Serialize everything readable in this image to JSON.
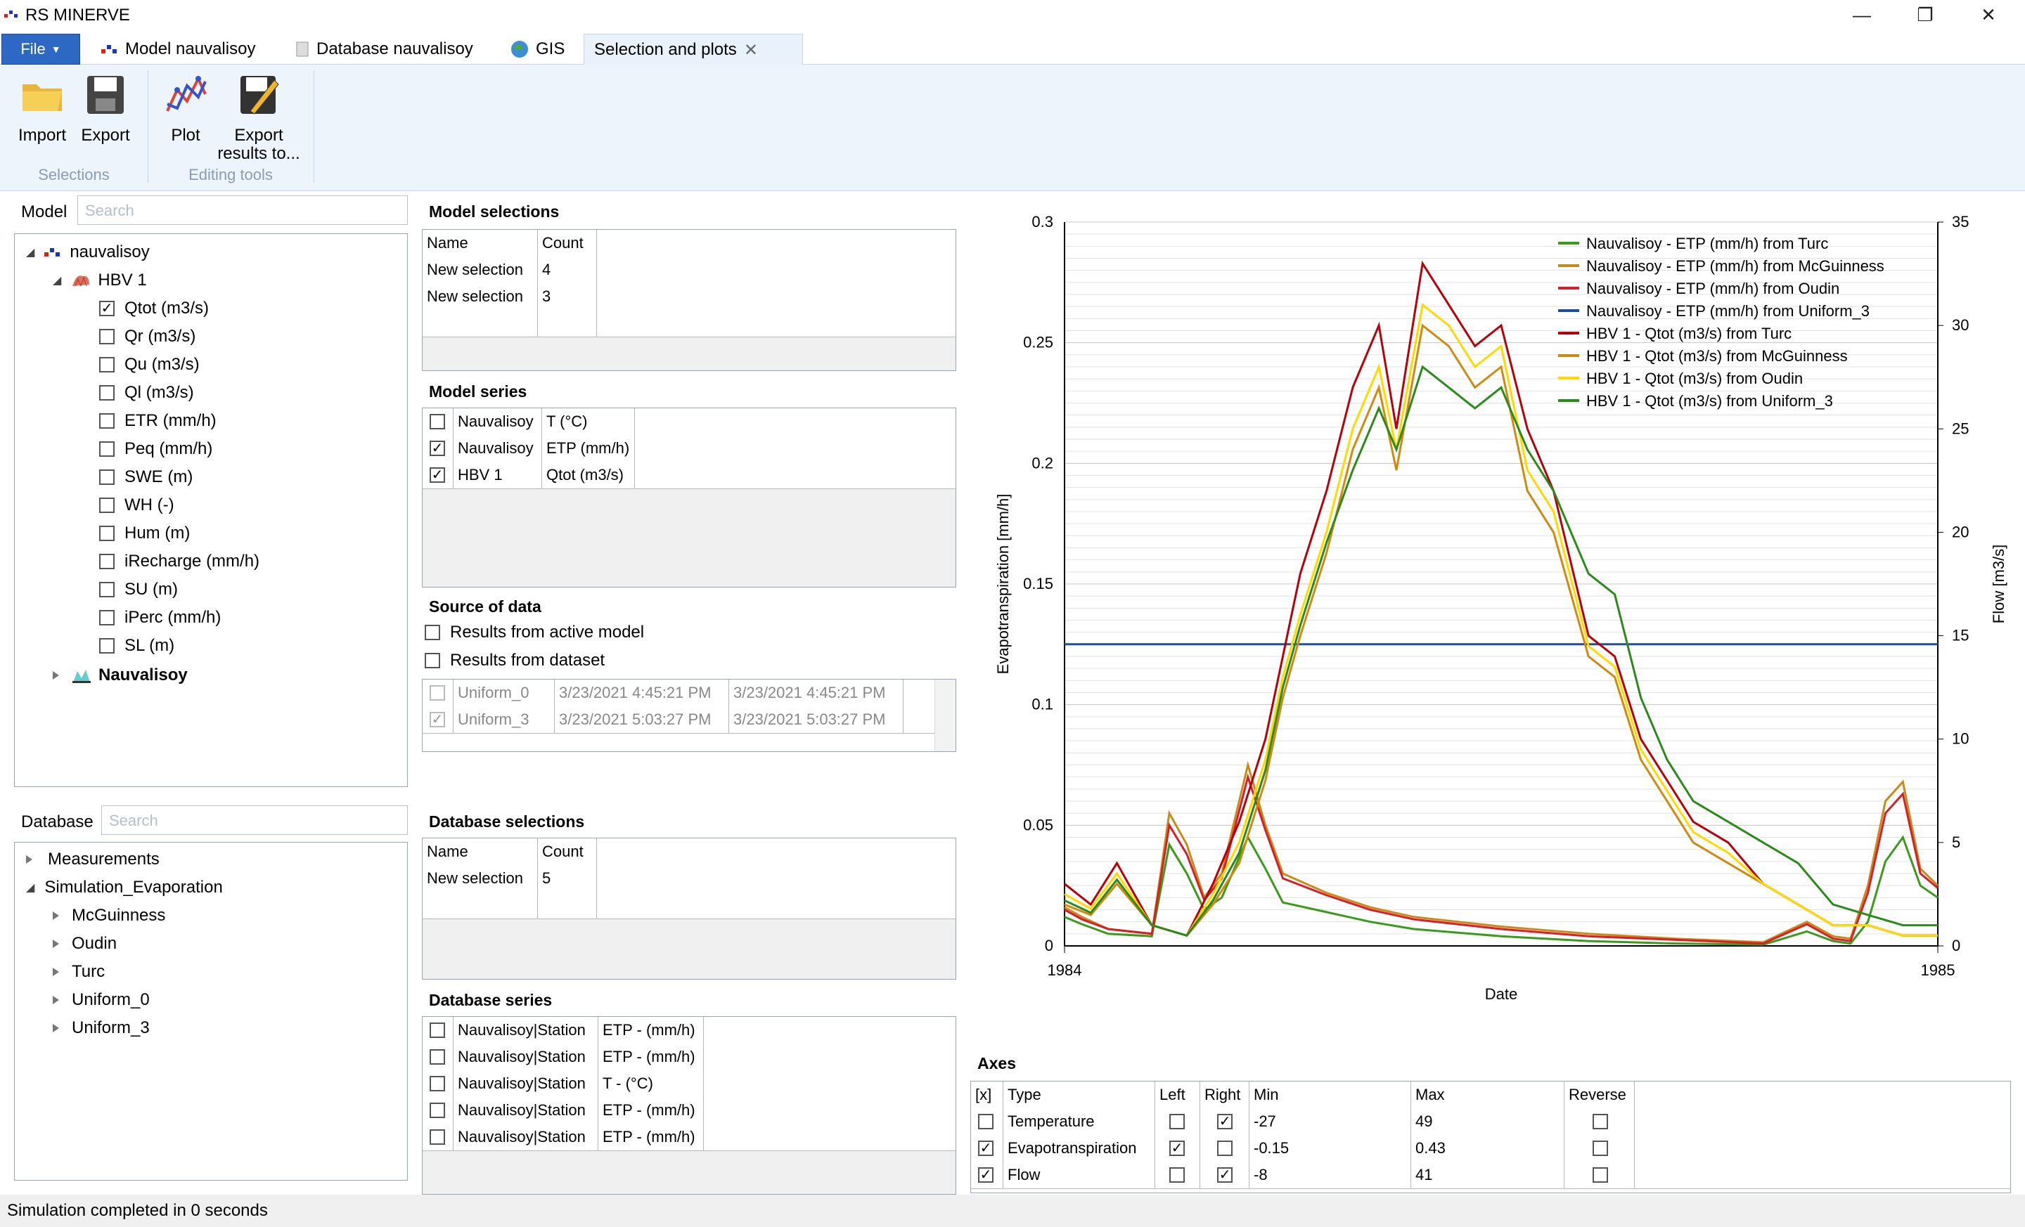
{
  "app": {
    "title": "RS MINERVE"
  },
  "window_controls": {
    "minimize": "—",
    "restore": "❐",
    "close": "✕"
  },
  "tabs": [
    {
      "label": "File"
    },
    {
      "label": "Model nauvalisoy"
    },
    {
      "label": "Database nauvalisoy"
    },
    {
      "label": "GIS"
    },
    {
      "label": "Selection and plots",
      "active": true
    }
  ],
  "ribbon": {
    "buttons": [
      {
        "label": "Import",
        "icon": "folder-icon"
      },
      {
        "label": "Export",
        "icon": "save-icon"
      },
      {
        "label": "Plot",
        "icon": "plot-icon"
      },
      {
        "label": "Export",
        "label2": "results to...",
        "icon": "export-results-icon"
      }
    ],
    "groups": [
      "Selections",
      "Editing tools"
    ]
  },
  "model": {
    "label": "Model",
    "search_placeholder": "Search",
    "tree": {
      "root": "nauvalisoy",
      "child": "HBV 1",
      "items": [
        {
          "label": "Qtot (m3/s)",
          "checked": true
        },
        {
          "label": "Qr (m3/s)",
          "checked": false
        },
        {
          "label": "Qu (m3/s)",
          "checked": false
        },
        {
          "label": "Ql (m3/s)",
          "checked": false
        },
        {
          "label": "ETR (mm/h)",
          "checked": false
        },
        {
          "label": "Peq (mm/h)",
          "checked": false
        },
        {
          "label": "SWE (m)",
          "checked": false
        },
        {
          "label": "WH (-)",
          "checked": false
        },
        {
          "label": "Hum (m)",
          "checked": false
        },
        {
          "label": "iRecharge (mm/h)",
          "checked": false
        },
        {
          "label": "SU (m)",
          "checked": false
        },
        {
          "label": "iPerc (mm/h)",
          "checked": false
        },
        {
          "label": "SL (m)",
          "checked": false
        }
      ],
      "station": "Nauvalisoy"
    }
  },
  "database": {
    "label": "Database",
    "search_placeholder": "Search",
    "tree": {
      "items": [
        "Measurements",
        "Simulation_Evaporation"
      ],
      "children": [
        "McGuinness",
        "Oudin",
        "Turc",
        "Uniform_0",
        "Uniform_3"
      ]
    }
  },
  "model_selections": {
    "title": "Model selections",
    "headers": [
      "Name",
      "Count"
    ],
    "rows": [
      [
        "New selection",
        "4"
      ],
      [
        "New selection",
        "3"
      ],
      [
        "",
        ""
      ]
    ]
  },
  "model_series": {
    "title": "Model series",
    "rows": [
      {
        "checked": false,
        "name": "Nauvalisoy",
        "series": "T (°C)"
      },
      {
        "checked": true,
        "name": "Nauvalisoy",
        "series": "ETP (mm/h)"
      },
      {
        "checked": true,
        "name": "HBV 1",
        "series": "Qtot (m3/s)"
      }
    ]
  },
  "source_of_data": {
    "title": "Source of data",
    "options": [
      "Results from active model",
      "Results from dataset"
    ],
    "datasets": [
      {
        "checked": false,
        "name": "Uniform_0",
        "start": "3/23/2021 4:45:21 PM",
        "end": "3/23/2021 4:45:21 PM"
      },
      {
        "checked": true,
        "name": "Uniform_3",
        "start": "3/23/2021 5:03:27 PM",
        "end": "3/23/2021 5:03:27 PM"
      }
    ]
  },
  "database_selections": {
    "title": "Database selections",
    "headers": [
      "Name",
      "Count"
    ],
    "rows": [
      [
        "New selection",
        "5"
      ],
      [
        "",
        ""
      ]
    ]
  },
  "database_series": {
    "title": "Database series",
    "rows": [
      {
        "checked": false,
        "name": "Nauvalisoy|Station",
        "series": "ETP - (mm/h)"
      },
      {
        "checked": false,
        "name": "Nauvalisoy|Station",
        "series": "ETP - (mm/h)"
      },
      {
        "checked": false,
        "name": "Nauvalisoy|Station",
        "series": "T - (°C)"
      },
      {
        "checked": false,
        "name": "Nauvalisoy|Station",
        "series": "ETP - (mm/h)"
      },
      {
        "checked": false,
        "name": "Nauvalisoy|Station",
        "series": "ETP - (mm/h)"
      }
    ]
  },
  "axes": {
    "title": "Axes",
    "headers": [
      "[x]",
      "Type",
      "Left",
      "Right",
      "Min",
      "Max",
      "Reverse"
    ],
    "rows": [
      {
        "x": false,
        "type": "Temperature",
        "left": false,
        "right": true,
        "min": "-27",
        "max": "49",
        "reverse": false
      },
      {
        "x": true,
        "type": "Evapotranspiration",
        "left": true,
        "right": false,
        "min": "-0.15",
        "max": "0.43",
        "reverse": false
      },
      {
        "x": true,
        "type": "Flow",
        "left": false,
        "right": true,
        "min": "-8",
        "max": "41",
        "reverse": false
      }
    ]
  },
  "status": {
    "text": "Simulation completed in 0 seconds"
  },
  "chart_data": {
    "type": "line",
    "xlabel": "Date",
    "ylabel_left": "Evapotranspiration [mm/h]",
    "ylabel_right": "Flow [m3/s]",
    "x_ticks": [
      "1984",
      "1985"
    ],
    "y_left_ticks": [
      "0",
      "0.05",
      "0.1",
      "0.15",
      "0.2",
      "0.25",
      "0.3"
    ],
    "y_right_ticks": [
      "0",
      "5",
      "10",
      "15",
      "20",
      "25",
      "30",
      "35"
    ],
    "y_left_range": [
      0,
      0.3
    ],
    "y_right_range": [
      0,
      35
    ],
    "x_range": [
      0,
      1
    ],
    "legend_position": "top-right",
    "series": [
      {
        "name": "Nauvalisoy - ETP (mm/h) from Turc",
        "axis": "left",
        "color": "#3a9a1a",
        "values": [
          [
            0.0,
            1.2
          ],
          [
            0.02,
            0.9
          ],
          [
            0.05,
            0.5
          ],
          [
            0.1,
            0.4
          ],
          [
            0.12,
            4.2
          ],
          [
            0.14,
            3.0
          ],
          [
            0.16,
            1.5
          ],
          [
            0.18,
            2.0
          ],
          [
            0.21,
            4.5
          ],
          [
            0.23,
            3.2
          ],
          [
            0.25,
            1.8
          ],
          [
            0.3,
            1.4
          ],
          [
            0.35,
            1.0
          ],
          [
            0.4,
            0.7
          ],
          [
            0.5,
            0.4
          ],
          [
            0.6,
            0.2
          ],
          [
            0.7,
            0.1
          ],
          [
            0.8,
            0.05
          ],
          [
            0.85,
            0.6
          ],
          [
            0.88,
            0.2
          ],
          [
            0.9,
            0.1
          ],
          [
            0.92,
            1.0
          ],
          [
            0.94,
            3.5
          ],
          [
            0.96,
            4.5
          ],
          [
            0.98,
            2.5
          ],
          [
            1.0,
            2.0
          ]
        ]
      },
      {
        "name": "Nauvalisoy - ETP (mm/h) from McGuinness",
        "axis": "left",
        "color": "#c98a1a",
        "values": [
          [
            0.0,
            1.6
          ],
          [
            0.02,
            1.2
          ],
          [
            0.05,
            0.7
          ],
          [
            0.1,
            0.5
          ],
          [
            0.12,
            5.5
          ],
          [
            0.14,
            4.2
          ],
          [
            0.16,
            2.0
          ],
          [
            0.18,
            3.0
          ],
          [
            0.21,
            7.5
          ],
          [
            0.23,
            5.0
          ],
          [
            0.25,
            3.0
          ],
          [
            0.3,
            2.2
          ],
          [
            0.35,
            1.6
          ],
          [
            0.4,
            1.2
          ],
          [
            0.5,
            0.8
          ],
          [
            0.6,
            0.5
          ],
          [
            0.7,
            0.3
          ],
          [
            0.8,
            0.15
          ],
          [
            0.85,
            1.0
          ],
          [
            0.88,
            0.4
          ],
          [
            0.9,
            0.3
          ],
          [
            0.92,
            2.5
          ],
          [
            0.94,
            6.0
          ],
          [
            0.96,
            6.8
          ],
          [
            0.98,
            3.2
          ],
          [
            1.0,
            2.5
          ]
        ]
      },
      {
        "name": "Nauvalisoy - ETP (mm/h) from Oudin",
        "axis": "left",
        "color": "#d4202a",
        "values": [
          [
            0.0,
            1.5
          ],
          [
            0.02,
            1.1
          ],
          [
            0.05,
            0.7
          ],
          [
            0.1,
            0.5
          ],
          [
            0.12,
            5.0
          ],
          [
            0.14,
            3.8
          ],
          [
            0.16,
            1.9
          ],
          [
            0.18,
            2.8
          ],
          [
            0.21,
            7.0
          ],
          [
            0.23,
            4.8
          ],
          [
            0.25,
            2.8
          ],
          [
            0.3,
            2.1
          ],
          [
            0.35,
            1.5
          ],
          [
            0.4,
            1.1
          ],
          [
            0.5,
            0.7
          ],
          [
            0.6,
            0.4
          ],
          [
            0.7,
            0.25
          ],
          [
            0.8,
            0.1
          ],
          [
            0.85,
            0.9
          ],
          [
            0.88,
            0.3
          ],
          [
            0.9,
            0.2
          ],
          [
            0.92,
            2.2
          ],
          [
            0.94,
            5.5
          ],
          [
            0.96,
            6.3
          ],
          [
            0.98,
            3.0
          ],
          [
            1.0,
            2.4
          ]
        ]
      },
      {
        "name": "Nauvalisoy - ETP (mm/h) from Uniform_3",
        "axis": "left",
        "color": "#1f4e9c",
        "values": [
          [
            0.0,
            0.125
          ],
          [
            1.0,
            0.125
          ]
        ]
      },
      {
        "name": "HBV 1 - Qtot (m3/s) from Turc",
        "axis": "right",
        "color": "#b8000a",
        "values": [
          [
            0.0,
            3
          ],
          [
            0.03,
            2
          ],
          [
            0.06,
            4
          ],
          [
            0.1,
            1
          ],
          [
            0.14,
            0.5
          ],
          [
            0.17,
            3
          ],
          [
            0.2,
            6
          ],
          [
            0.23,
            10
          ],
          [
            0.25,
            14
          ],
          [
            0.27,
            18
          ],
          [
            0.3,
            22
          ],
          [
            0.33,
            27
          ],
          [
            0.36,
            30
          ],
          [
            0.38,
            25
          ],
          [
            0.41,
            33
          ],
          [
            0.44,
            31
          ],
          [
            0.47,
            29
          ],
          [
            0.5,
            30
          ],
          [
            0.53,
            25
          ],
          [
            0.56,
            22
          ],
          [
            0.6,
            15
          ],
          [
            0.63,
            14
          ],
          [
            0.66,
            10
          ],
          [
            0.69,
            8
          ],
          [
            0.72,
            6
          ],
          [
            0.76,
            5
          ],
          [
            0.8,
            3
          ],
          [
            0.84,
            2
          ],
          [
            0.88,
            1
          ],
          [
            0.92,
            1
          ],
          [
            0.96,
            0.5
          ],
          [
            1.0,
            0.5
          ]
        ]
      },
      {
        "name": "HBV 1 - Qtot (m3/s) from McGuinness",
        "axis": "right",
        "color": "#d08a10",
        "values": [
          [
            0.0,
            2
          ],
          [
            0.03,
            1.5
          ],
          [
            0.06,
            3
          ],
          [
            0.1,
            1
          ],
          [
            0.14,
            0.5
          ],
          [
            0.17,
            2
          ],
          [
            0.2,
            4
          ],
          [
            0.23,
            8
          ],
          [
            0.25,
            12
          ],
          [
            0.27,
            15
          ],
          [
            0.3,
            19
          ],
          [
            0.33,
            24
          ],
          [
            0.36,
            27
          ],
          [
            0.38,
            23
          ],
          [
            0.41,
            30
          ],
          [
            0.44,
            29
          ],
          [
            0.47,
            27
          ],
          [
            0.5,
            28
          ],
          [
            0.53,
            22
          ],
          [
            0.56,
            20
          ],
          [
            0.6,
            14
          ],
          [
            0.63,
            13
          ],
          [
            0.66,
            9
          ],
          [
            0.69,
            7
          ],
          [
            0.72,
            5
          ],
          [
            0.76,
            4
          ],
          [
            0.8,
            3
          ],
          [
            0.84,
            2
          ],
          [
            0.88,
            1
          ],
          [
            0.92,
            1
          ],
          [
            0.96,
            0.5
          ],
          [
            1.0,
            0.5
          ]
        ]
      },
      {
        "name": "HBV 1 - Qtot (m3/s) from Oudin",
        "axis": "right",
        "color": "#ffd900",
        "values": [
          [
            0.0,
            2.5
          ],
          [
            0.03,
            1.8
          ],
          [
            0.06,
            3.5
          ],
          [
            0.1,
            1
          ],
          [
            0.14,
            0.5
          ],
          [
            0.17,
            2.5
          ],
          [
            0.2,
            5
          ],
          [
            0.23,
            9
          ],
          [
            0.25,
            13
          ],
          [
            0.27,
            16
          ],
          [
            0.3,
            20
          ],
          [
            0.33,
            25
          ],
          [
            0.36,
            28
          ],
          [
            0.38,
            24
          ],
          [
            0.41,
            31
          ],
          [
            0.44,
            30
          ],
          [
            0.47,
            28
          ],
          [
            0.5,
            29
          ],
          [
            0.53,
            23
          ],
          [
            0.56,
            21
          ],
          [
            0.6,
            14.5
          ],
          [
            0.63,
            13.5
          ],
          [
            0.66,
            9.5
          ],
          [
            0.69,
            7.5
          ],
          [
            0.72,
            5.5
          ],
          [
            0.76,
            4.5
          ],
          [
            0.8,
            3
          ],
          [
            0.84,
            2
          ],
          [
            0.88,
            1
          ],
          [
            0.92,
            1
          ],
          [
            0.96,
            0.5
          ],
          [
            1.0,
            0.5
          ]
        ]
      },
      {
        "name": "HBV 1 - Qtot (m3/s) from Uniform_3",
        "axis": "right",
        "color": "#2a8a1a",
        "values": [
          [
            0.0,
            2.2
          ],
          [
            0.03,
            1.6
          ],
          [
            0.06,
            3.2
          ],
          [
            0.1,
            1
          ],
          [
            0.14,
            0.5
          ],
          [
            0.17,
            2.2
          ],
          [
            0.2,
            4.5
          ],
          [
            0.23,
            8.5
          ],
          [
            0.25,
            12.5
          ],
          [
            0.27,
            15.5
          ],
          [
            0.3,
            19.5
          ],
          [
            0.33,
            23
          ],
          [
            0.36,
            26
          ],
          [
            0.38,
            24
          ],
          [
            0.41,
            28
          ],
          [
            0.44,
            27
          ],
          [
            0.47,
            26
          ],
          [
            0.5,
            27
          ],
          [
            0.53,
            24
          ],
          [
            0.56,
            22
          ],
          [
            0.6,
            18
          ],
          [
            0.63,
            17
          ],
          [
            0.66,
            12
          ],
          [
            0.69,
            9
          ],
          [
            0.72,
            7
          ],
          [
            0.76,
            6
          ],
          [
            0.8,
            5
          ],
          [
            0.84,
            4
          ],
          [
            0.88,
            2
          ],
          [
            0.92,
            1.5
          ],
          [
            0.96,
            1
          ],
          [
            1.0,
            1
          ]
        ]
      }
    ]
  }
}
